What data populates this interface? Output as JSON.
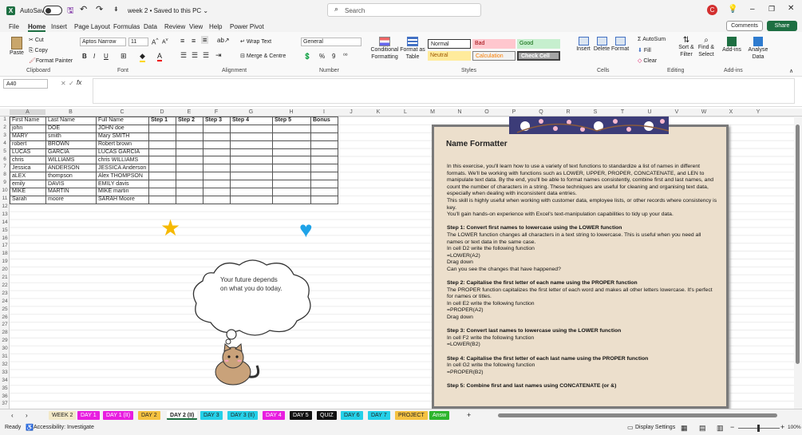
{
  "title_bar": {
    "autosave_label": "AutoSave",
    "autosave_state": "Off",
    "doc_title": "week 2 • Saved to this PC ⌄",
    "search_placeholder": "Search",
    "avatar_initial": "C"
  },
  "menu": [
    "File",
    "Home",
    "Insert",
    "Page Layout",
    "Formulas",
    "Data",
    "Review",
    "View",
    "Help",
    "Power Pivot"
  ],
  "menu_right": {
    "comments": "Comments",
    "share": "Share"
  },
  "ribbon": {
    "paste": "Paste",
    "cut": "Cut",
    "copy": "Copy",
    "format_painter": "Format Painter",
    "font_name": "Aptos Narrow",
    "font_size": "11",
    "wrap_text": "Wrap Text",
    "merge_center": "Merge & Centre",
    "number_format": "General",
    "conditional": "Conditional Formatting",
    "format_table": "Format as Table",
    "styles": {
      "normal": "Normal",
      "bad": "Bad",
      "good": "Good",
      "neutral": "Neutral",
      "calculation": "Calculation",
      "check_cell": "Check Cell"
    },
    "insert": "Insert",
    "delete": "Delete",
    "format": "Format",
    "autosum": "AutoSum",
    "fill": "Fill",
    "clear": "Clear",
    "sort_filter": "Sort & Filter",
    "find_select": "Find & Select",
    "addins": "Add-ins",
    "analyse": "Analyse Data",
    "groups": {
      "clipboard": "Clipboard",
      "font": "Font",
      "alignment": "Alignment",
      "number": "Number",
      "styles": "Styles",
      "cells": "Cells",
      "editing": "Editing",
      "addins": "Add-ins"
    }
  },
  "formula_bar": {
    "name_box": "A40",
    "fx": "fx",
    "value": ""
  },
  "columns": [
    "A",
    "B",
    "C",
    "D",
    "E",
    "F",
    "G",
    "H",
    "I",
    "J",
    "K",
    "L",
    "M",
    "N",
    "O",
    "P",
    "Q",
    "R",
    "S",
    "T",
    "U",
    "V",
    "W",
    "X",
    "Y"
  ],
  "rows": [
    "1",
    "2",
    "3",
    "4",
    "5",
    "6",
    "7",
    "8",
    "9",
    "10",
    "11",
    "12",
    "13",
    "14",
    "15",
    "16",
    "17",
    "18",
    "19",
    "20",
    "21",
    "22",
    "23",
    "24",
    "25",
    "26",
    "27",
    "28",
    "29",
    "30",
    "31",
    "32",
    "33",
    "34",
    "35",
    "36",
    "37"
  ],
  "table": {
    "headers": [
      "First Name",
      "Last Name",
      "Full Name",
      "Step 1",
      "Step 2",
      "Step 3",
      "Step 4",
      "Step 5",
      "Bonus"
    ],
    "rows": [
      [
        "john",
        "DOE",
        "JOHN doe"
      ],
      [
        "MARY",
        "smith",
        "Mary SMITH"
      ],
      [
        "robert",
        "BROWN",
        "Robert brown"
      ],
      [
        "LUCAS",
        "GARCIA",
        "LUCAS GARCIA"
      ],
      [
        "chris",
        "WILLIAMS",
        "chris WILLIAMS"
      ],
      [
        "Jessica",
        "ANDERSON",
        "JESSICA Anderson"
      ],
      [
        "aLEX",
        "thompson",
        "Alex THOMPSON"
      ],
      [
        "emily",
        "DAVIS",
        "EMILY davis"
      ],
      [
        "MIKE",
        "MARTIN",
        "MIKE martin"
      ],
      [
        "Sarah",
        "moore",
        "SARAH Moore"
      ]
    ]
  },
  "thought_bubble": "Your future depends on what you do today.",
  "panel": {
    "title": "Name Formatter",
    "intro": "In this exercise, you'll learn how to use a variety of text functions to standardize a list of names in different formats. We'll be working with functions such as LOWER, UPPER, PROPER, CONCATENATE, and LEN to manipulate text data. By the end, you'll be able to format names consistently, combine first and last names, and count the number of characters in a string. These techniques are useful for cleaning and organising text data, especially when dealing with inconsistent data entries.",
    "intro2": "This skill is highly useful when working with customer data, employee lists, or other records where consistency is key.",
    "intro3": "You'll gain hands-on experience with Excel's text-manipulation capabilities to tidy up your data.",
    "step1_title": "Step 1: Convert  first names to lowercase using the LOWER function",
    "step1_body": "The LOWER function changes all characters in a text string to lowercase. This is useful when you need all names or text data in the same case.",
    "step1_l1": "In cell D2 write the following function",
    "step1_l2": "=LOWER(A2)",
    "step1_l3": "Drag down",
    "step1_l4": "Can you see the changes that have happened?",
    "step2_title": "Step 2: Capitalise the first letter of each name using the PROPER function",
    "step2_body": "The PROPER function capitalizes the first letter of each word and makes all other letters lowercase. It's perfect for names or titles.",
    "step2_l1": "In cell E2 write the following function",
    "step2_l2": "=PROPER(A2)",
    "step2_l3": "Drag down",
    "step3_title": "Step 3: Convert  last names to lowercase using the LOWER function",
    "step3_l1": "In cell F2 write the following function",
    "step3_l2": "=LOWER(B2)",
    "step4_title": "Step 4: Capitalise the first letter of each last name using the PROPER function",
    "step4_l1": "In cell G2 write the following function",
    "step4_l2": "=PROPER(B2)",
    "step5_title": "Step 5: Combine first and last names using CONCATENATE (or &)"
  },
  "sheets": [
    {
      "name": "WEEK 2",
      "bg": "#f3e9c8",
      "fg": "#222"
    },
    {
      "name": "DAY 1",
      "bg": "#e81ee0",
      "fg": "#fff"
    },
    {
      "name": "DAY 1 (II)",
      "bg": "#e81ee0",
      "fg": "#fff"
    },
    {
      "name": "DAY 2",
      "bg": "#f5c242",
      "fg": "#222"
    },
    {
      "name": "DAY 2 (II)",
      "bg": "#ffffff",
      "fg": "#222"
    },
    {
      "name": "DAY 3",
      "bg": "#25d0e8",
      "fg": "#222"
    },
    {
      "name": "DAY 3 (II)",
      "bg": "#25d0e8",
      "fg": "#222"
    },
    {
      "name": "DAY 4",
      "bg": "#e81ee0",
      "fg": "#fff"
    },
    {
      "name": "DAY 5",
      "bg": "#111111",
      "fg": "#fff"
    },
    {
      "name": "QUIZ",
      "bg": "#111111",
      "fg": "#fff"
    },
    {
      "name": "DAY 6",
      "bg": "#25d0e8",
      "fg": "#222"
    },
    {
      "name": "DAY 7",
      "bg": "#25d0e8",
      "fg": "#222"
    },
    {
      "name": "PROJECT",
      "bg": "#f5c242",
      "fg": "#222"
    },
    {
      "name": "Answ",
      "bg": "#2db52d",
      "fg": "#fff"
    }
  ],
  "status": {
    "ready": "Ready",
    "accessibility": "Accessibility: Investigate",
    "display": "Display Settings",
    "zoom": "100%"
  }
}
